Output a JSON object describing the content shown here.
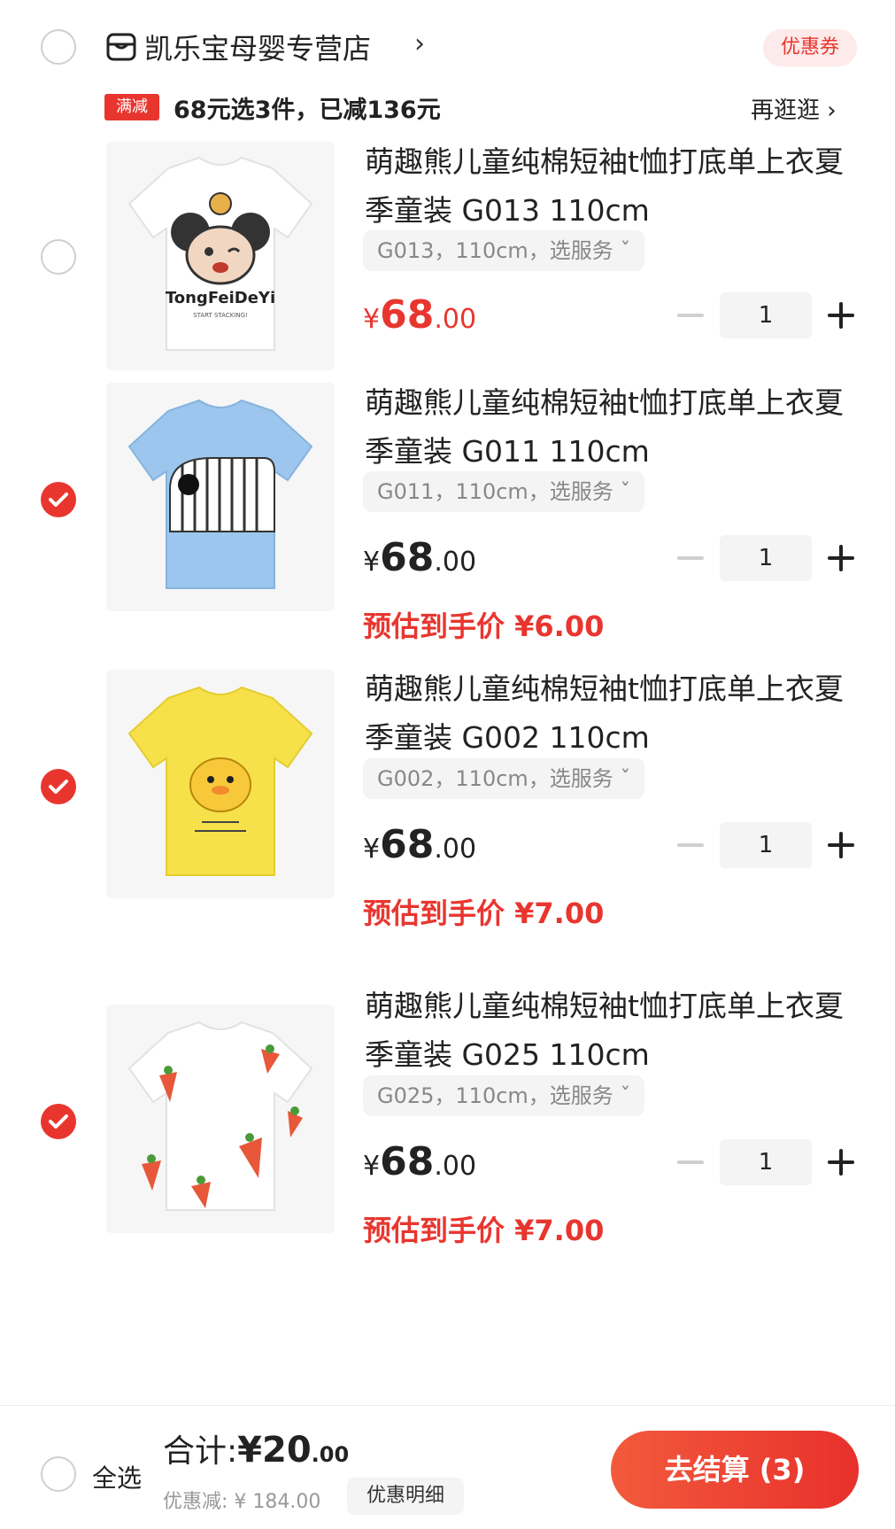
{
  "store": {
    "name": "凯乐宝母婴专营店",
    "chevron": "›",
    "coupon_label": "优惠券"
  },
  "promo": {
    "tag": "满减",
    "text": "68元选3件，已减136元",
    "browse_label": "再逛逛 ›"
  },
  "items": [
    {
      "checked": false,
      "image": "white-tshirt-cartoon-mouse",
      "image_text": "TongFeiDeYi",
      "image_subtext": "START STACKING!",
      "title": "萌趣熊儿童纯棉短袖t恤打底单上衣夏季童装 G013 110cm",
      "sku": "G013，110cm，选服务 ˇ",
      "price_symbol": "¥",
      "price_int": "68",
      "price_dec": ".00",
      "price_red": true,
      "qty": "1",
      "estimate": ""
    },
    {
      "checked": true,
      "image": "blue-tshirt-elephant",
      "title": "萌趣熊儿童纯棉短袖t恤打底单上衣夏季童装 G011 110cm",
      "sku": "G011，110cm，选服务 ˇ",
      "price_symbol": "¥",
      "price_int": "68",
      "price_dec": ".00",
      "price_red": false,
      "qty": "1",
      "estimate": "预估到手价 ¥6.00"
    },
    {
      "checked": true,
      "image": "yellow-tshirt-duck",
      "title": "萌趣熊儿童纯棉短袖t恤打底单上衣夏季童装 G002 110cm",
      "sku": "G002，110cm，选服务 ˇ",
      "price_symbol": "¥",
      "price_int": "68",
      "price_dec": ".00",
      "price_red": false,
      "qty": "1",
      "estimate": "预估到手价 ¥7.00"
    },
    {
      "checked": true,
      "image": "white-tshirt-carrots",
      "title": "萌趣熊儿童纯棉短袖t恤打底单上衣夏季童装 G025 110cm",
      "sku": "G025，110cm，选服务 ˇ",
      "price_symbol": "¥",
      "price_int": "68",
      "price_dec": ".00",
      "price_red": false,
      "qty": "1",
      "estimate": "预估到手价 ¥7.00"
    }
  ],
  "footer": {
    "select_all_label": "全选",
    "total_label": "合计:",
    "total_symbol": "¥",
    "total_int": "20",
    "total_dec": ".00",
    "discount_text": "优惠减: ¥ 184.00",
    "detail_label": "优惠明细",
    "checkout_label": "去结算 (3)"
  },
  "colors": {
    "accent": "#e8362f",
    "muted": "#888888"
  }
}
